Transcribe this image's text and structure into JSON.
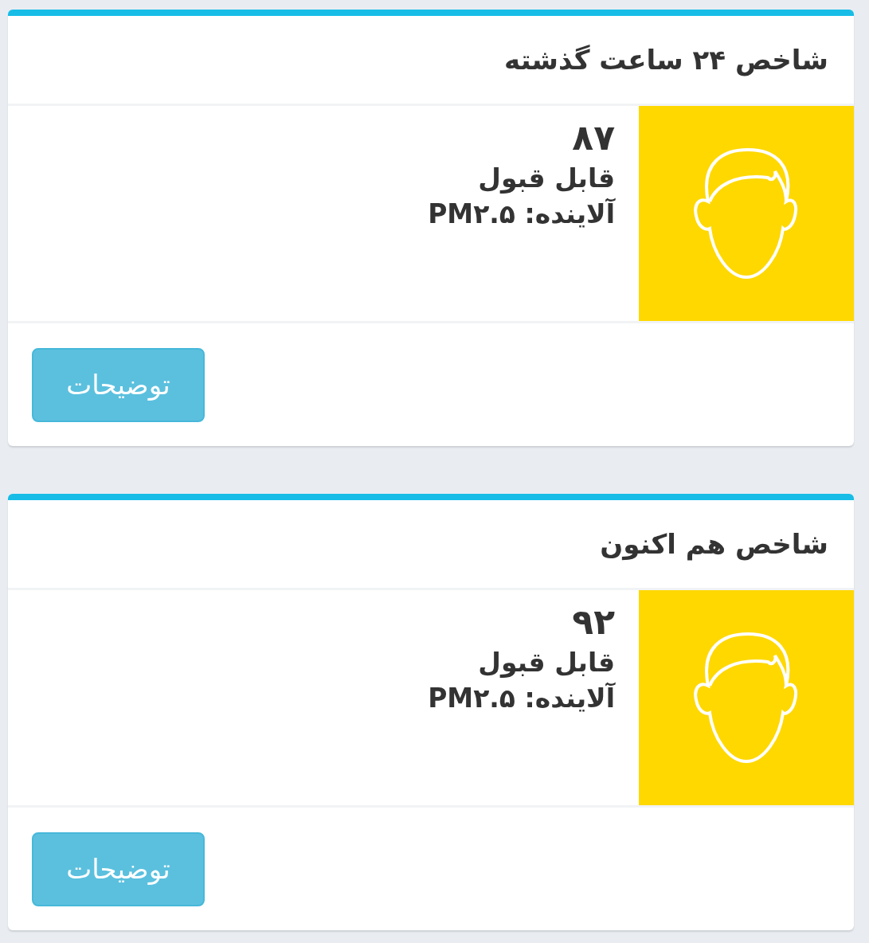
{
  "cards": [
    {
      "title": "شاخص ۲۴ ساعت گذشته",
      "aqi": "۸۷",
      "status": "قابل قبول",
      "pollutant": "آلاینده: PM۲.۵",
      "color": "#ffd800",
      "button": "توضیحات"
    },
    {
      "title": "شاخص هم اکنون",
      "aqi": "۹۲",
      "status": "قابل قبول",
      "pollutant": "آلاینده: PM۲.۵",
      "color": "#ffd800",
      "button": "توضیحات"
    }
  ]
}
